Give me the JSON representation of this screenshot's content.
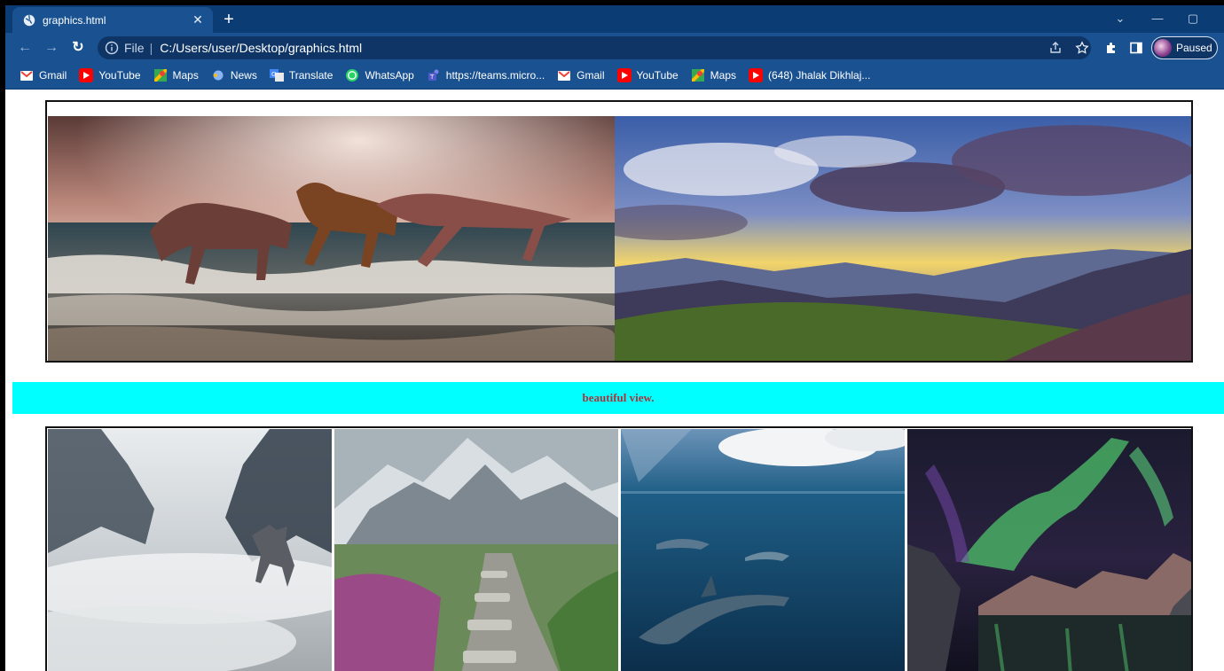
{
  "browser": {
    "tab_title": "graphics.html",
    "address_prefix": "File",
    "address_separator": "|",
    "url": "C:/Users/user/Desktop/graphics.html",
    "profile_label": "Paused",
    "theme": {
      "tabstrip": "#0b3d74",
      "toolbar": "#1a5291"
    }
  },
  "bookmarks": [
    {
      "label": "Gmail",
      "icon": "gmail-icon"
    },
    {
      "label": "YouTube",
      "icon": "youtube-icon"
    },
    {
      "label": "Maps",
      "icon": "maps-icon"
    },
    {
      "label": "News",
      "icon": "news-icon"
    },
    {
      "label": "Translate",
      "icon": "translate-icon"
    },
    {
      "label": "WhatsApp",
      "icon": "whatsapp-icon"
    },
    {
      "label": "https://teams.micro...",
      "icon": "teams-icon"
    },
    {
      "label": "Gmail",
      "icon": "gmail-icon"
    },
    {
      "label": "YouTube",
      "icon": "youtube-icon"
    },
    {
      "label": "Maps",
      "icon": "maps-icon"
    },
    {
      "label": "(648) Jhalak Dikhlaj...",
      "icon": "youtube-icon"
    }
  ],
  "page": {
    "banner_text": "beautiful view.",
    "banner_color": "#00ffff",
    "top_images": [
      "horses-running-on-beach-image",
      "mountain-sunset-clouds-image"
    ],
    "bottom_images": [
      "misty-forest-wolf-image",
      "mountain-stone-path-image",
      "underwater-dolphins-image",
      "aurora-lake-night-image"
    ]
  }
}
